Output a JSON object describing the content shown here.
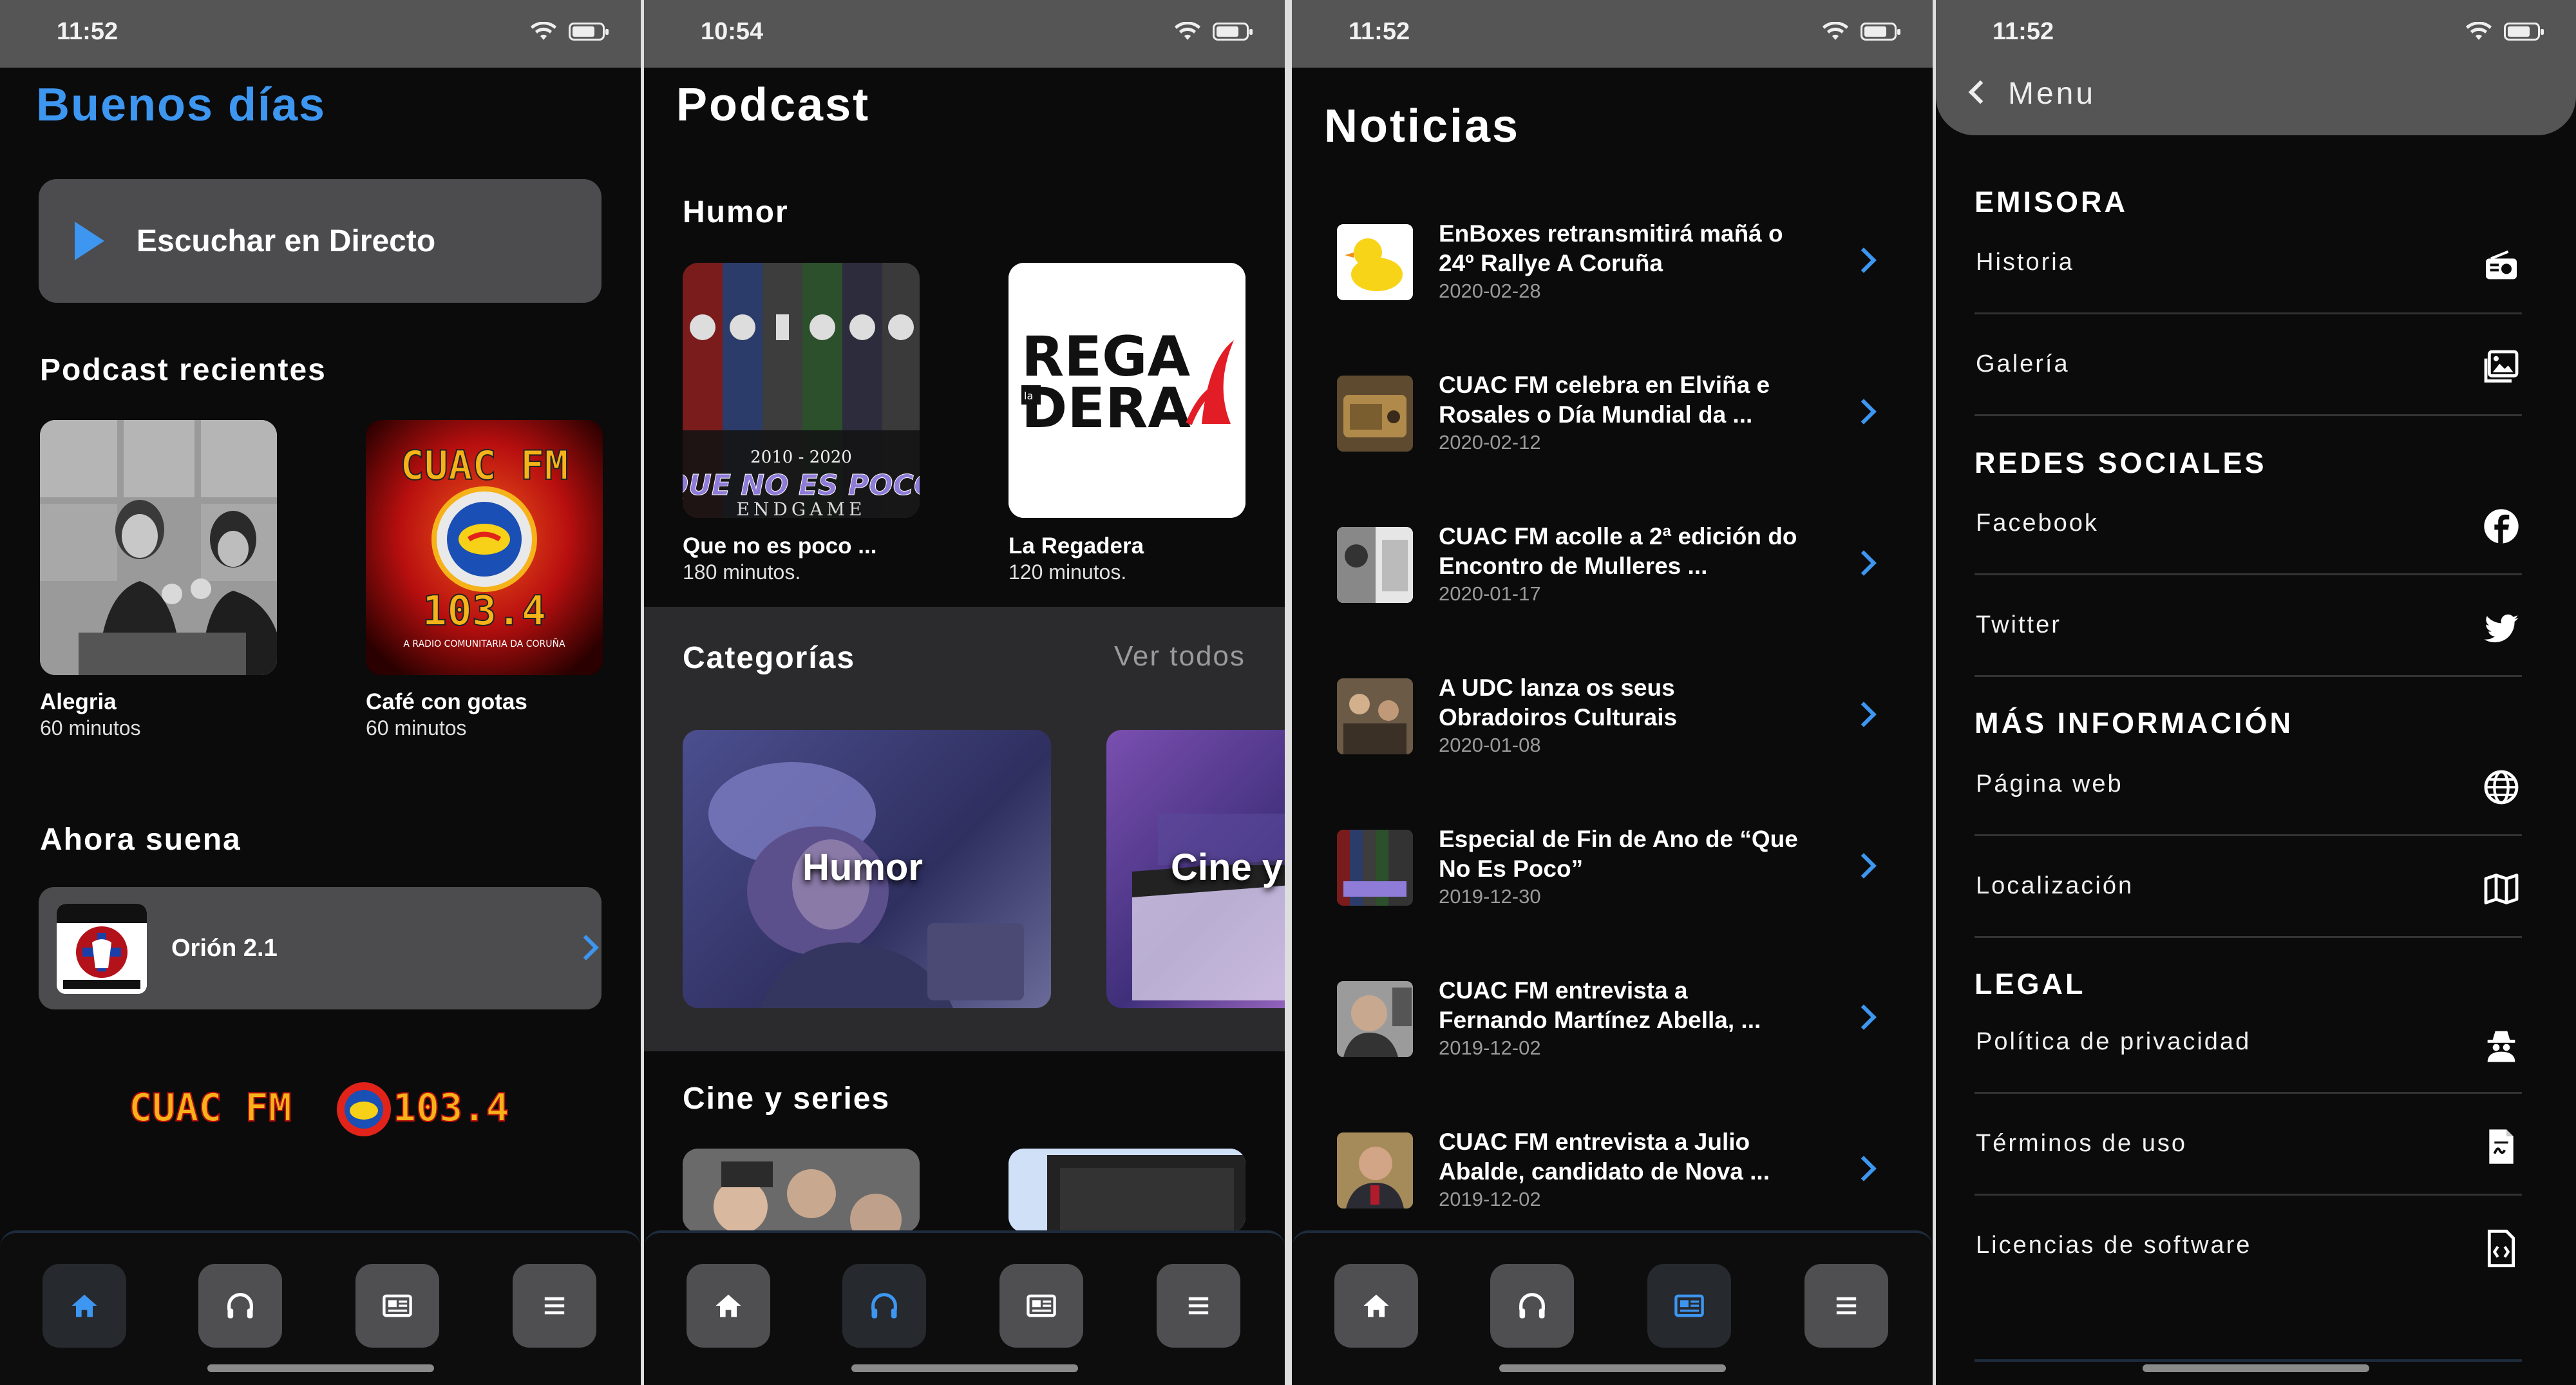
{
  "screens": {
    "home": {
      "time": "11:52",
      "greeting": "Buenos días",
      "live_button": "Escuchar en Directo",
      "recent_title": "Podcast recientes",
      "recent": [
        {
          "title": "Alegria",
          "duration": "60 minutos"
        },
        {
          "title": "Café con gotas",
          "duration": "60 minutos"
        }
      ],
      "now_title": "Ahora suena",
      "now_playing": "Orión 2.1",
      "logo_text": "CUAC FM",
      "logo_freq": "103.4",
      "cuac_logo_text": "CUAC FM",
      "cuac_logo_freq": "103.4",
      "cuac_logo_sub": "A RADIO COMUNITARIA DA CORUÑA"
    },
    "podcast": {
      "time": "10:54",
      "title": "Podcast",
      "humor_title": "Humor",
      "humor_items": [
        {
          "title": "Que no es poco ...",
          "duration": "180 minutos."
        },
        {
          "title": "La Regadera",
          "duration": "120 minutos."
        }
      ],
      "poster_year": "2010 - 2020",
      "poster_title": "QUE NO ES POCO",
      "poster_sub": "ENDGAME",
      "regadera_1": "REGA",
      "regadera_2": "DERA",
      "regadera_la": "la",
      "categories_title": "Categorías",
      "see_all": "Ver todos",
      "categories": [
        "Humor",
        "Cine y"
      ],
      "cine_title": "Cine y series"
    },
    "news": {
      "time": "11:52",
      "title": "Noticias",
      "items": [
        {
          "title": "EnBoxes retransmitirá mañá o 24º Rallye A Coruña",
          "date": "2020-02-28"
        },
        {
          "title": "CUAC FM celebra en Elviña e Rosales o Día Mundial da ...",
          "date": "2020-02-12"
        },
        {
          "title": "CUAC FM acolle a 2ª edición do Encontro de Mulleres ...",
          "date": "2020-01-17"
        },
        {
          "title": "A UDC lanza os seus Obradoiros Culturais",
          "date": "2020-01-08"
        },
        {
          "title": "Especial de Fin de Ano de “Que No Es Poco”",
          "date": "2019-12-30"
        },
        {
          "title": "CUAC FM entrevista a Fernando Martínez Abella, ...",
          "date": "2019-12-02"
        },
        {
          "title": "CUAC FM entrevista a Julio Abalde, candidato de Nova ...",
          "date": "2019-12-02"
        }
      ]
    },
    "menu": {
      "time": "11:52",
      "header": "Menu",
      "sections": [
        {
          "title": "EMISORA",
          "items": [
            {
              "label": "Historia",
              "icon": "radio-icon"
            },
            {
              "label": "Galería",
              "icon": "gallery-icon"
            }
          ]
        },
        {
          "title": "REDES SOCIALES",
          "items": [
            {
              "label": "Facebook",
              "icon": "facebook-icon"
            },
            {
              "label": "Twitter",
              "icon": "twitter-icon"
            }
          ]
        },
        {
          "title": "MÁS INFORMACIÓN",
          "items": [
            {
              "label": "Página web",
              "icon": "globe-icon"
            },
            {
              "label": "Localización",
              "icon": "map-icon"
            }
          ]
        },
        {
          "title": "LEGAL",
          "items": [
            {
              "label": "Política de privacidad",
              "icon": "spy-icon"
            },
            {
              "label": "Términos de uso",
              "icon": "document-icon"
            },
            {
              "label": "Licencias de software",
              "icon": "code-file-icon"
            }
          ]
        }
      ]
    }
  },
  "tabs": [
    "home-icon",
    "headphones-icon",
    "news-icon",
    "menu-icon"
  ],
  "colors": {
    "accent": "#3d96f0",
    "card": "#4c4c4e",
    "background": "#0b0b0b",
    "statusbar": "#555555"
  }
}
